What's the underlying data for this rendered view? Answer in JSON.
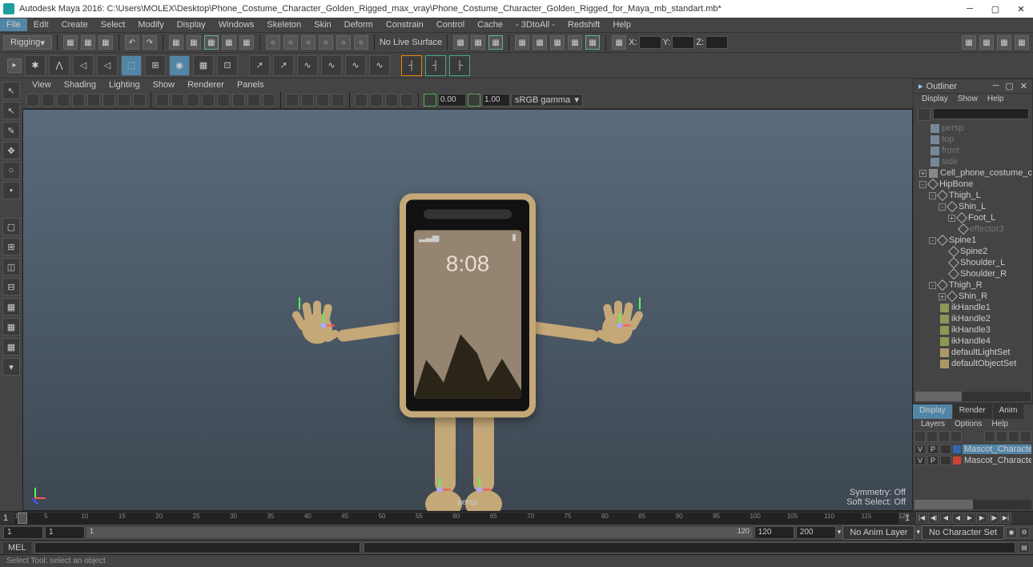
{
  "title": "Autodesk Maya 2016: C:\\Users\\MOLEX\\Desktop\\Phone_Costume_Character_Golden_Rigged_max_vray\\Phone_Costume_Character_Golden_Rigged_for_Maya_mb_standart.mb*",
  "menubar": [
    "File",
    "Edit",
    "Create",
    "Select",
    "Modify",
    "Display",
    "Windows",
    "Skeleton",
    "Skin",
    "Deform",
    "Constrain",
    "Control",
    "Cache",
    "- 3DtoAll -",
    "Redshift",
    "Help"
  ],
  "workspace_dropdown": "Rigging",
  "surface_label": "No Live Surface",
  "xyz": {
    "x": "X:",
    "y": "Y:",
    "z": "Z:"
  },
  "vp_menu": [
    "View",
    "Shading",
    "Lighting",
    "Show",
    "Renderer",
    "Panels"
  ],
  "vp_vals": {
    "a": "0.00",
    "b": "1.00"
  },
  "vp_dropdown": "sRGB gamma",
  "vp_camera": "persp",
  "vp_status": {
    "sym": "Symmetry:",
    "sym_v": "Off",
    "soft": "Soft Select:",
    "soft_v": "Off"
  },
  "phone_time": "8:08",
  "outliner": {
    "title": "Outliner",
    "menu": [
      "Display",
      "Show",
      "Help"
    ],
    "tree": [
      {
        "ind": 0,
        "ico": "cam",
        "lbl": "persp",
        "dim": true
      },
      {
        "ind": 0,
        "ico": "cam",
        "lbl": "top",
        "dim": true
      },
      {
        "ind": 0,
        "ico": "cam",
        "lbl": "front",
        "dim": true
      },
      {
        "ind": 0,
        "ico": "cam",
        "lbl": "side",
        "dim": true
      },
      {
        "ind": 0,
        "ico": "grp",
        "lbl": "Cell_phone_costume_cha",
        "exp": "+"
      },
      {
        "ind": 0,
        "ico": "jnt",
        "lbl": "HipBone",
        "exp": "-"
      },
      {
        "ind": 1,
        "ico": "jnt",
        "lbl": "Thigh_L",
        "exp": "-"
      },
      {
        "ind": 2,
        "ico": "jnt",
        "lbl": "Shin_L",
        "exp": "-"
      },
      {
        "ind": 3,
        "ico": "jnt",
        "lbl": "Foot_L",
        "exp": "+"
      },
      {
        "ind": 3,
        "ico": "jnt",
        "lbl": "effector3",
        "dim": true
      },
      {
        "ind": 1,
        "ico": "jnt",
        "lbl": "Spine1",
        "exp": "-"
      },
      {
        "ind": 2,
        "ico": "jnt",
        "lbl": "Spine2"
      },
      {
        "ind": 2,
        "ico": "jnt",
        "lbl": "Shoulder_L"
      },
      {
        "ind": 2,
        "ico": "jnt",
        "lbl": "Shoulder_R"
      },
      {
        "ind": 1,
        "ico": "jnt",
        "lbl": "Thigh_R",
        "exp": "-"
      },
      {
        "ind": 2,
        "ico": "jnt",
        "lbl": "Shin_R",
        "exp": "+"
      },
      {
        "ind": 1,
        "ico": "ik",
        "lbl": "ikHandle1"
      },
      {
        "ind": 1,
        "ico": "ik",
        "lbl": "ikHandle2"
      },
      {
        "ind": 1,
        "ico": "ik",
        "lbl": "ikHandle3"
      },
      {
        "ind": 1,
        "ico": "ik",
        "lbl": "ikHandle4"
      },
      {
        "ind": 1,
        "ico": "set",
        "lbl": "defaultLightSet"
      },
      {
        "ind": 1,
        "ico": "set",
        "lbl": "defaultObjectSet"
      }
    ]
  },
  "channelbox": {
    "tabs": [
      "Display",
      "Render",
      "Anim"
    ],
    "menu": [
      "Layers",
      "Options",
      "Help"
    ],
    "layers": [
      {
        "v": "V",
        "p": "P",
        "color": "#36a",
        "name": "Mascot_Character_Mobile_P",
        "sel": true
      },
      {
        "v": "V",
        "p": "P",
        "color": "#c43",
        "name": "Mascot_Character_Mo"
      }
    ]
  },
  "timeline": {
    "ticks": [
      1,
      5,
      10,
      15,
      20,
      25,
      30,
      35,
      40,
      45,
      50,
      55,
      60,
      65,
      70,
      75,
      80,
      85,
      90,
      95,
      100,
      105,
      110,
      115,
      120
    ],
    "cur": "1"
  },
  "range": {
    "start": "1",
    "in": "1",
    "out": "120",
    "end": "120",
    "frame": "120",
    "fps": "200",
    "anim": "No Anim Layer",
    "charset": "No Character Set"
  },
  "cmd": {
    "label": "MEL"
  },
  "help": "Select Tool: select an object"
}
